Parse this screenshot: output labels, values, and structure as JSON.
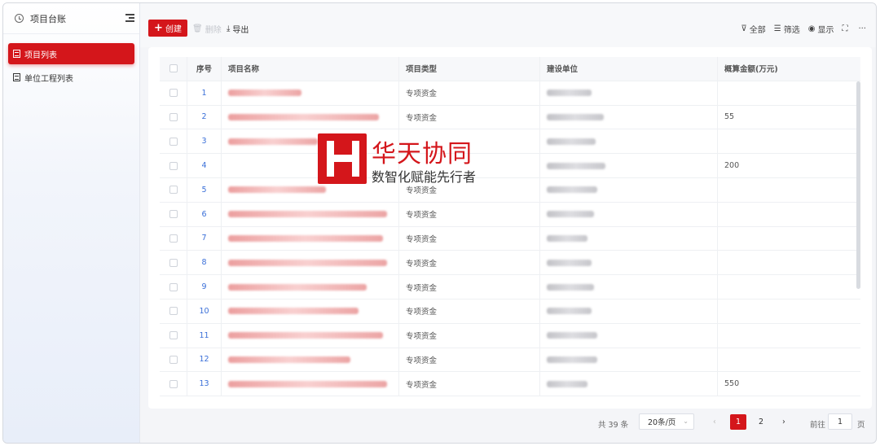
{
  "sidebar": {
    "title": "项目台账",
    "items": [
      {
        "label": "项目列表",
        "active": true
      },
      {
        "label": "单位工程列表",
        "active": false
      }
    ]
  },
  "toolbar": {
    "create_label": "创建",
    "delete_label": "删除",
    "export_label": "导出",
    "all_label": "全部",
    "filter_label": "筛选",
    "display_label": "显示",
    "more_label": "···"
  },
  "table": {
    "columns": [
      "序号",
      "项目名称",
      "项目类型",
      "建设单位",
      "概算金额(万元)"
    ],
    "rows": [
      {
        "index": "1",
        "type": "专项资金",
        "amount": ""
      },
      {
        "index": "2",
        "type": "专项资金",
        "amount": "55"
      },
      {
        "index": "3",
        "type": "",
        "amount": ""
      },
      {
        "index": "4",
        "type": "",
        "amount": "200"
      },
      {
        "index": "5",
        "type": "专项资金",
        "amount": ""
      },
      {
        "index": "6",
        "type": "专项资金",
        "amount": ""
      },
      {
        "index": "7",
        "type": "专项资金",
        "amount": ""
      },
      {
        "index": "8",
        "type": "专项资金",
        "amount": ""
      },
      {
        "index": "9",
        "type": "专项资金",
        "amount": ""
      },
      {
        "index": "10",
        "type": "专项资金",
        "amount": ""
      },
      {
        "index": "11",
        "type": "专项资金",
        "amount": ""
      },
      {
        "index": "12",
        "type": "专项资金",
        "amount": ""
      },
      {
        "index": "13",
        "type": "专项资金",
        "amount": "550"
      }
    ]
  },
  "pagination": {
    "total_text": "共 39 条",
    "page_size": "20条/页",
    "pages": [
      "1",
      "2"
    ],
    "current_page": "1",
    "goto_label": "前往",
    "goto_value": "1",
    "page_unit": "页"
  },
  "watermark": {
    "name": "华天协同",
    "slogan": "数智化赋能先行者"
  },
  "colors": {
    "accent": "#d4161b",
    "link": "#3a6fd8"
  }
}
